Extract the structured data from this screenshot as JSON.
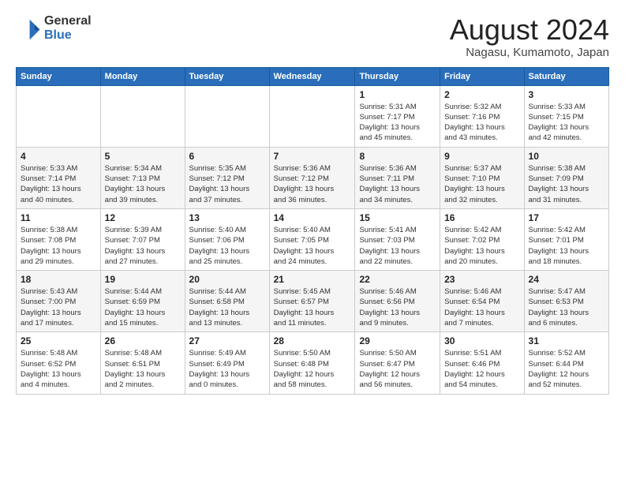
{
  "header": {
    "logo_general": "General",
    "logo_blue": "Blue",
    "main_title": "August 2024",
    "subtitle": "Nagasu, Kumamoto, Japan"
  },
  "calendar": {
    "weekdays": [
      "Sunday",
      "Monday",
      "Tuesday",
      "Wednesday",
      "Thursday",
      "Friday",
      "Saturday"
    ],
    "weeks": [
      [
        {
          "day": "",
          "info": ""
        },
        {
          "day": "",
          "info": ""
        },
        {
          "day": "",
          "info": ""
        },
        {
          "day": "",
          "info": ""
        },
        {
          "day": "1",
          "info": "Sunrise: 5:31 AM\nSunset: 7:17 PM\nDaylight: 13 hours\nand 45 minutes."
        },
        {
          "day": "2",
          "info": "Sunrise: 5:32 AM\nSunset: 7:16 PM\nDaylight: 13 hours\nand 43 minutes."
        },
        {
          "day": "3",
          "info": "Sunrise: 5:33 AM\nSunset: 7:15 PM\nDaylight: 13 hours\nand 42 minutes."
        }
      ],
      [
        {
          "day": "4",
          "info": "Sunrise: 5:33 AM\nSunset: 7:14 PM\nDaylight: 13 hours\nand 40 minutes."
        },
        {
          "day": "5",
          "info": "Sunrise: 5:34 AM\nSunset: 7:13 PM\nDaylight: 13 hours\nand 39 minutes."
        },
        {
          "day": "6",
          "info": "Sunrise: 5:35 AM\nSunset: 7:12 PM\nDaylight: 13 hours\nand 37 minutes."
        },
        {
          "day": "7",
          "info": "Sunrise: 5:36 AM\nSunset: 7:12 PM\nDaylight: 13 hours\nand 36 minutes."
        },
        {
          "day": "8",
          "info": "Sunrise: 5:36 AM\nSunset: 7:11 PM\nDaylight: 13 hours\nand 34 minutes."
        },
        {
          "day": "9",
          "info": "Sunrise: 5:37 AM\nSunset: 7:10 PM\nDaylight: 13 hours\nand 32 minutes."
        },
        {
          "day": "10",
          "info": "Sunrise: 5:38 AM\nSunset: 7:09 PM\nDaylight: 13 hours\nand 31 minutes."
        }
      ],
      [
        {
          "day": "11",
          "info": "Sunrise: 5:38 AM\nSunset: 7:08 PM\nDaylight: 13 hours\nand 29 minutes."
        },
        {
          "day": "12",
          "info": "Sunrise: 5:39 AM\nSunset: 7:07 PM\nDaylight: 13 hours\nand 27 minutes."
        },
        {
          "day": "13",
          "info": "Sunrise: 5:40 AM\nSunset: 7:06 PM\nDaylight: 13 hours\nand 25 minutes."
        },
        {
          "day": "14",
          "info": "Sunrise: 5:40 AM\nSunset: 7:05 PM\nDaylight: 13 hours\nand 24 minutes."
        },
        {
          "day": "15",
          "info": "Sunrise: 5:41 AM\nSunset: 7:03 PM\nDaylight: 13 hours\nand 22 minutes."
        },
        {
          "day": "16",
          "info": "Sunrise: 5:42 AM\nSunset: 7:02 PM\nDaylight: 13 hours\nand 20 minutes."
        },
        {
          "day": "17",
          "info": "Sunrise: 5:42 AM\nSunset: 7:01 PM\nDaylight: 13 hours\nand 18 minutes."
        }
      ],
      [
        {
          "day": "18",
          "info": "Sunrise: 5:43 AM\nSunset: 7:00 PM\nDaylight: 13 hours\nand 17 minutes."
        },
        {
          "day": "19",
          "info": "Sunrise: 5:44 AM\nSunset: 6:59 PM\nDaylight: 13 hours\nand 15 minutes."
        },
        {
          "day": "20",
          "info": "Sunrise: 5:44 AM\nSunset: 6:58 PM\nDaylight: 13 hours\nand 13 minutes."
        },
        {
          "day": "21",
          "info": "Sunrise: 5:45 AM\nSunset: 6:57 PM\nDaylight: 13 hours\nand 11 minutes."
        },
        {
          "day": "22",
          "info": "Sunrise: 5:46 AM\nSunset: 6:56 PM\nDaylight: 13 hours\nand 9 minutes."
        },
        {
          "day": "23",
          "info": "Sunrise: 5:46 AM\nSunset: 6:54 PM\nDaylight: 13 hours\nand 7 minutes."
        },
        {
          "day": "24",
          "info": "Sunrise: 5:47 AM\nSunset: 6:53 PM\nDaylight: 13 hours\nand 6 minutes."
        }
      ],
      [
        {
          "day": "25",
          "info": "Sunrise: 5:48 AM\nSunset: 6:52 PM\nDaylight: 13 hours\nand 4 minutes."
        },
        {
          "day": "26",
          "info": "Sunrise: 5:48 AM\nSunset: 6:51 PM\nDaylight: 13 hours\nand 2 minutes."
        },
        {
          "day": "27",
          "info": "Sunrise: 5:49 AM\nSunset: 6:49 PM\nDaylight: 13 hours\nand 0 minutes."
        },
        {
          "day": "28",
          "info": "Sunrise: 5:50 AM\nSunset: 6:48 PM\nDaylight: 12 hours\nand 58 minutes."
        },
        {
          "day": "29",
          "info": "Sunrise: 5:50 AM\nSunset: 6:47 PM\nDaylight: 12 hours\nand 56 minutes."
        },
        {
          "day": "30",
          "info": "Sunrise: 5:51 AM\nSunset: 6:46 PM\nDaylight: 12 hours\nand 54 minutes."
        },
        {
          "day": "31",
          "info": "Sunrise: 5:52 AM\nSunset: 6:44 PM\nDaylight: 12 hours\nand 52 minutes."
        }
      ]
    ]
  }
}
